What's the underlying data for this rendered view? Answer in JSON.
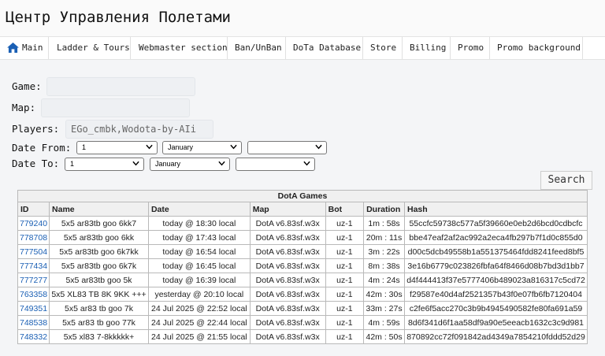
{
  "app": {
    "title": "Центр Управления Полетами"
  },
  "nav": {
    "items": [
      {
        "label": "Main",
        "icon": "home-icon"
      },
      {
        "label": "Ladder & Tours"
      },
      {
        "label": "Webmaster section"
      },
      {
        "label": "Ban/UnBan"
      },
      {
        "label": "DoTa Database"
      },
      {
        "label": "Store"
      },
      {
        "label": "Billing"
      },
      {
        "label": "Promo"
      },
      {
        "label": "Promo background"
      }
    ]
  },
  "form": {
    "game_label": "Game:",
    "game_value": "",
    "map_label": "Map:",
    "map_value": "",
    "players_label": "Players:",
    "players_value": "EGo_cmbk,Wodota-by-AIi",
    "date_from_label": "Date From:",
    "date_to_label": "Date To:",
    "from_day": "1",
    "from_month": "January",
    "from_year": "",
    "to_day": "1",
    "to_month": "January",
    "to_year": "",
    "search_label": "Search"
  },
  "table": {
    "caption": "DotA Games",
    "headers": [
      "ID",
      "Name",
      "Date",
      "Map",
      "Bot",
      "Duration",
      "Hash"
    ],
    "rows": [
      [
        "779240",
        "5x5 ar83tb goo 6kk7",
        "today @ 18:30 local",
        "DotA v6.83sf.w3x",
        "uz-1",
        "1m : 58s",
        "55ccfc59738c577a5f39660e0eb2d6bcd0cdbcfc"
      ],
      [
        "778708",
        "5x5 ar83tb goo 6kk",
        "today @ 17:43 local",
        "DotA v6.83sf.w3x",
        "uz-1",
        "20m : 11s",
        "bbe47eaf2af2ac992a2eca4fb297b7f1d0c855d0"
      ],
      [
        "777504",
        "5x5 ar83tb goo 6k7kk",
        "today @ 16:54 local",
        "DotA v6.83sf.w3x",
        "uz-1",
        "3m : 22s",
        "d00c5dcb49558b1a551375464fdd8241feed8bf5"
      ],
      [
        "777434",
        "5x5 ar83tb goo 6k7k",
        "today @ 16:45 local",
        "DotA v6.83sf.w3x",
        "uz-1",
        "8m : 38s",
        "3e16b6779c023826fbfa64f8466d08b7bd3d1bb7"
      ],
      [
        "777277",
        "5x5 ar83tb goo 5k",
        "today @ 16:39 local",
        "DotA v6.83sf.w3x",
        "uz-1",
        "4m : 24s",
        "d4f444413f37e5777406b489023a816317c5cd72"
      ],
      [
        "763358",
        "5x5 XL83 TB 8K 9KK +++",
        "yesterday @ 20:10 local",
        "DotA v6.83sf.w3x",
        "uz-1",
        "42m : 30s",
        "f29587e40d4af2521357b43f0e07fb6fb7120404"
      ],
      [
        "749351",
        "5x5 ar83 tb goo 7k",
        "24 Jul 2025 @ 22:52 local",
        "DotA v6.83sf.w3x",
        "uz-1",
        "33m : 27s",
        "c2fe6f5acc270c3b9b4945490582fe80fa691a59"
      ],
      [
        "748538",
        "5x5 ar83 tb goo 77k",
        "24 Jul 2025 @ 22:44 local",
        "DotA v6.83sf.w3x",
        "uz-1",
        "4m : 59s",
        "8d6f341d6f1aa58df9a90e5eeacb1632c3c9d981"
      ],
      [
        "748332",
        "5x5 xl83 7-8kkkkk+",
        "24 Jul 2025 @ 21:55 local",
        "DotA v6.83sf.w3x",
        "uz-1",
        "42m : 50s",
        "870892cc72f091842ad4349a7854210fddd52d29"
      ]
    ]
  },
  "colors": {
    "link": "#1a5fb4",
    "home_icon": "#1a5fb4"
  }
}
